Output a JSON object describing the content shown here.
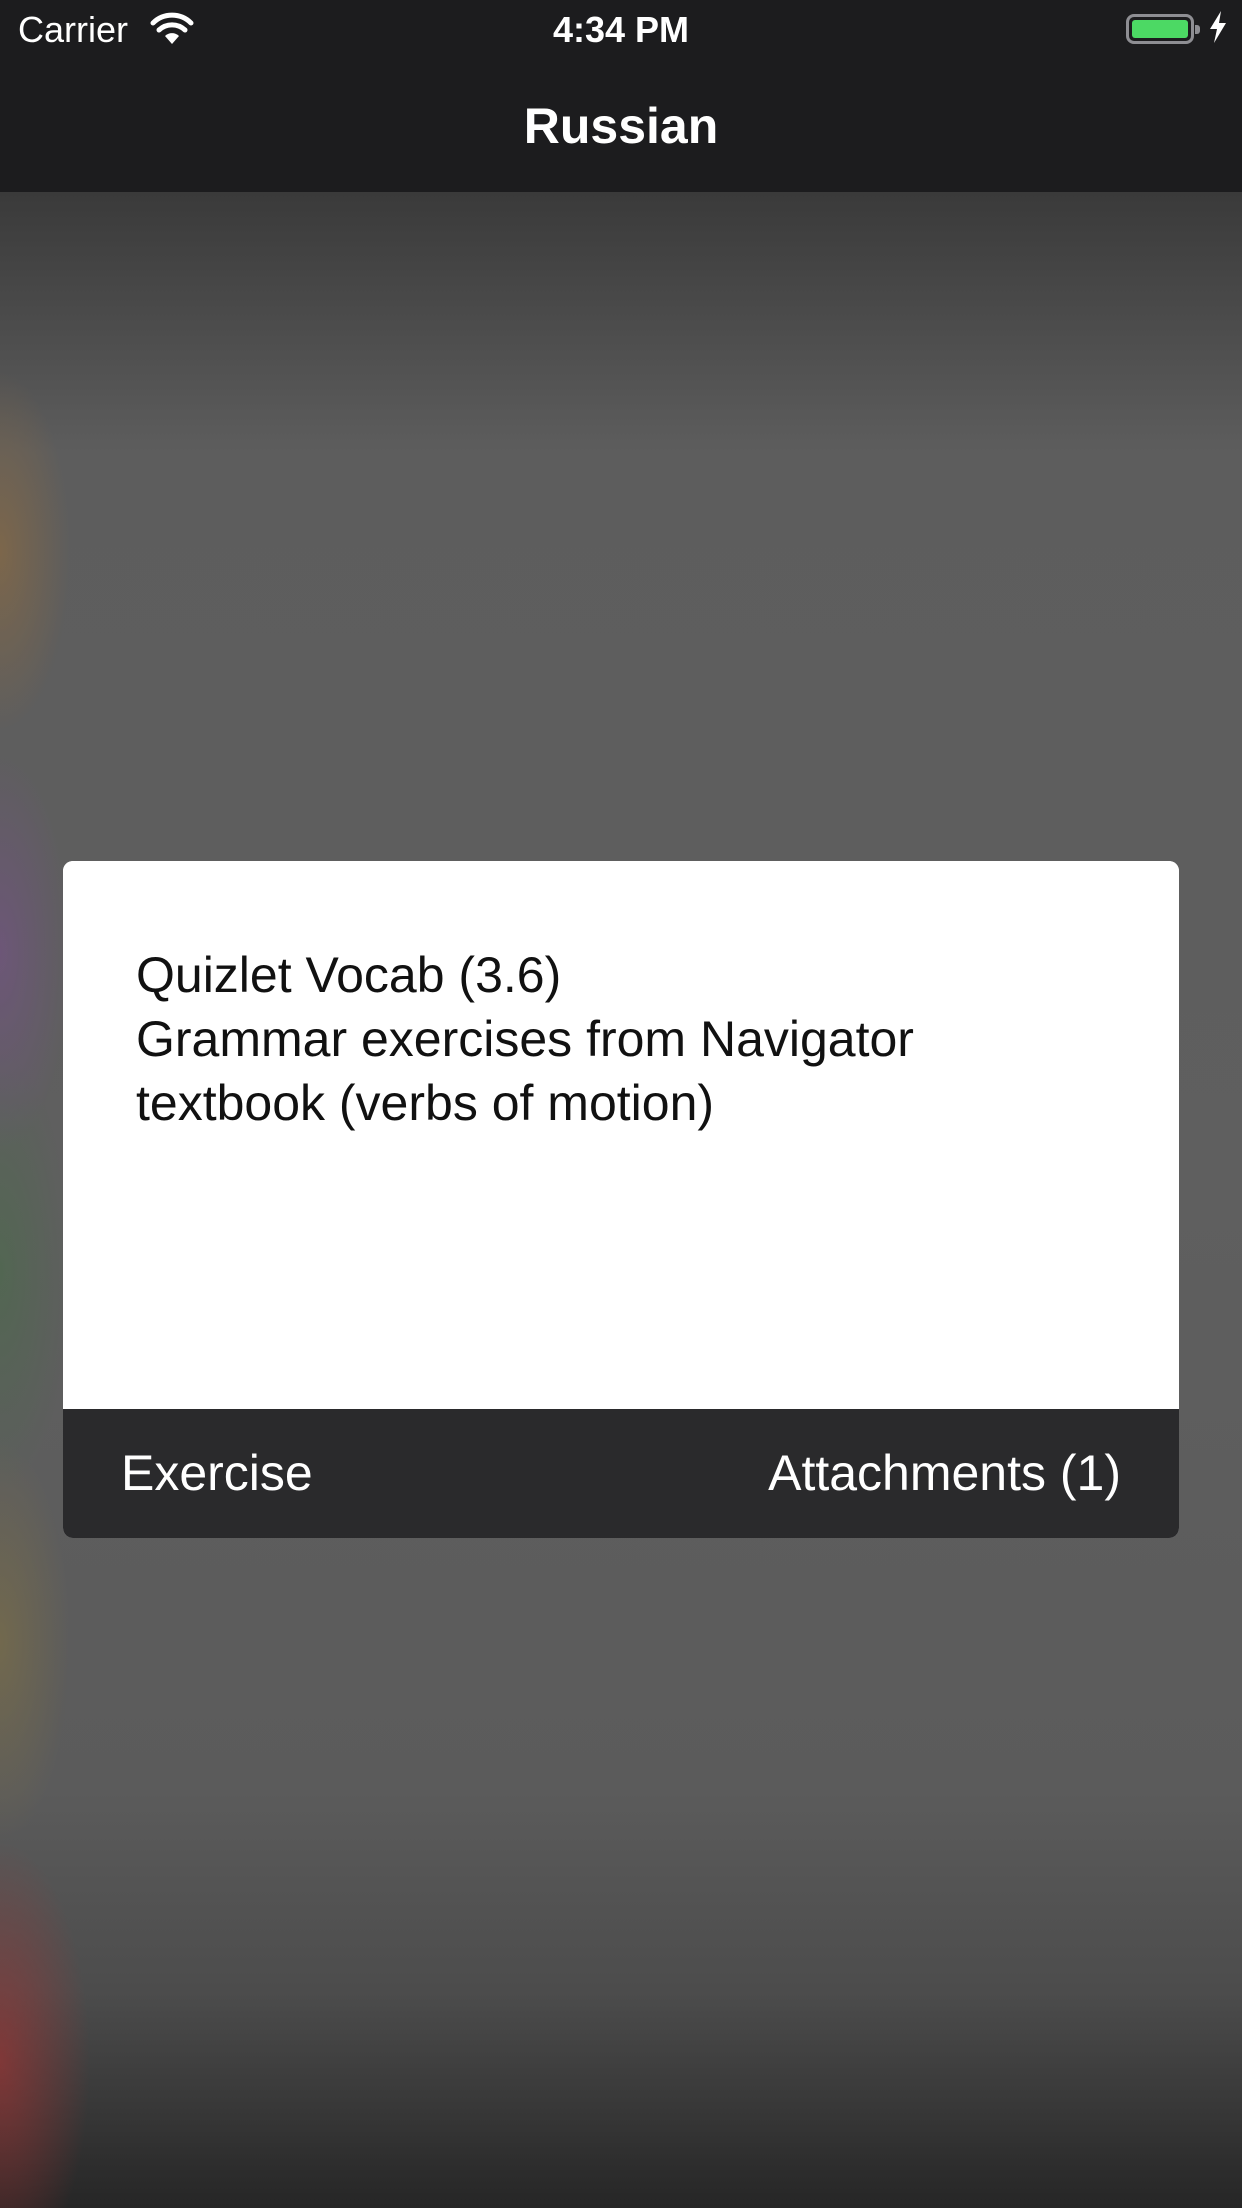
{
  "status_bar": {
    "carrier": "Carrier",
    "time": "4:34 PM",
    "battery_level": 1.0,
    "battery_color": "#4cd964",
    "icons": [
      "wifi-icon",
      "battery-icon",
      "charging-bolt-icon"
    ]
  },
  "nav": {
    "title": "Russian"
  },
  "card": {
    "lines": [
      "Quizlet Vocab (3.6)",
      "Grammar exercises from Navigator",
      "textbook (verbs of motion)"
    ],
    "footer": {
      "exercise_label": "Exercise",
      "attachments_label": "Attachments (1)"
    }
  },
  "colors": {
    "bar_background": "#1c1c1e",
    "card_footer": "#2a2a2c",
    "card_body": "#ffffff"
  }
}
